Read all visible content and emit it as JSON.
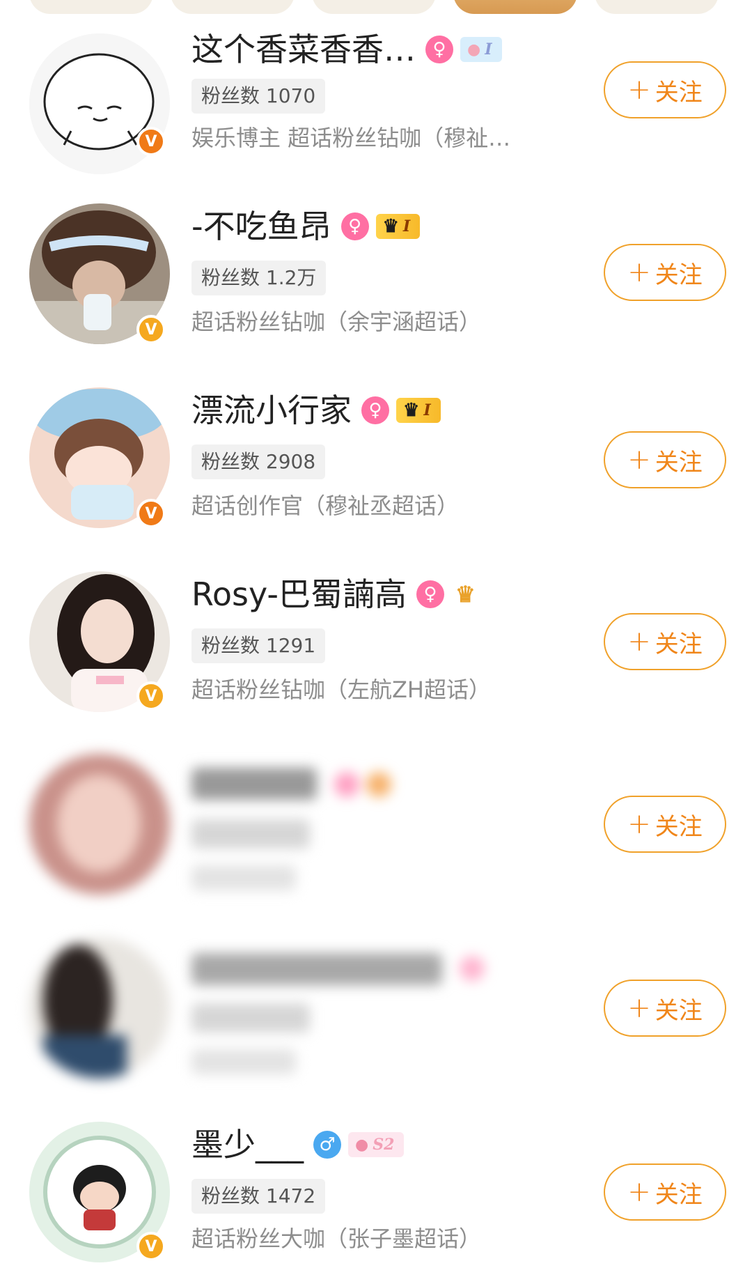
{
  "users": [
    {
      "name": "这个香菜香香…",
      "gender": "female",
      "gender_glyph": "♀",
      "level_text": "I",
      "level_style": "pig",
      "fans": "粉丝数 1070",
      "desc": "娱乐博主 超话粉丝钻咖（穆祉…",
      "verified": "orange",
      "verify_glyph": "V",
      "follow_label": "关注"
    },
    {
      "name": "-不吃鱼昂",
      "gender": "female",
      "gender_glyph": "♀",
      "level_text": "I",
      "level_style": "crown",
      "fans": "粉丝数 1.2万",
      "desc": "超话粉丝钻咖（余宇涵超话）",
      "verified": "yellow",
      "verify_glyph": "V",
      "follow_label": "关注"
    },
    {
      "name": "漂流小行家",
      "gender": "female",
      "gender_glyph": "♀",
      "level_text": "I",
      "level_style": "crown",
      "fans": "粉丝数 2908",
      "desc": "超话创作官（穆祉丞超话）",
      "verified": "orange",
      "verify_glyph": "V",
      "follow_label": "关注"
    },
    {
      "name": "Rosy-巴蜀諵高",
      "gender": "female",
      "gender_glyph": "♀",
      "level_text": "",
      "level_style": "medal",
      "fans": "粉丝数 1291",
      "desc": "超话粉丝钻咖（左航ZH超话）",
      "verified": "yellow",
      "verify_glyph": "V",
      "follow_label": "关注"
    },
    {
      "name": "",
      "blurred": true,
      "follow_label": "关注"
    },
    {
      "name": "",
      "blurred": true,
      "follow_label": "关注"
    },
    {
      "name": "墨少___",
      "gender": "male",
      "gender_glyph": "♂",
      "level_text": "S2",
      "level_style": "pig2",
      "fans": "粉丝数 1472",
      "desc": "超话粉丝大咖（张子墨超话）",
      "verified": "yellow",
      "verify_glyph": "V",
      "follow_label": "关注"
    }
  ],
  "follow_plus": "+",
  "colors": {
    "accent": "#f0861a",
    "button_border": "#f0a12a",
    "female": "#ff6fa3",
    "male": "#4aa8f0",
    "verified_yellow": "#f5a81f",
    "verified_orange": "#f07a17"
  },
  "icons": {
    "crown": "crown-icon",
    "pig": "pig-icon",
    "medal": "medal-icon"
  }
}
